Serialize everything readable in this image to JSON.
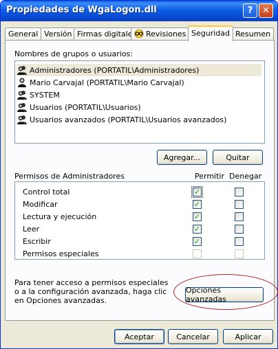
{
  "window": {
    "title": "Propiedades de WgaLogon.dll"
  },
  "titlebar_buttons": {
    "help": "?",
    "close": "✕"
  },
  "tabs": [
    {
      "label": "General"
    },
    {
      "label": "Versión"
    },
    {
      "label": "Firmas digitales"
    },
    {
      "label": "Revisiones"
    },
    {
      "label": "Seguridad"
    },
    {
      "label": "Resumen"
    }
  ],
  "groups": {
    "label": "Nombres de grupos o usuarios:",
    "items": [
      {
        "name": "Administradores (PORTATIL\\Administradores)",
        "selected": true
      },
      {
        "name": "Mario Carvajal (PORTATIL\\Mario Carvajal)",
        "selected": false
      },
      {
        "name": "SYSTEM",
        "selected": false
      },
      {
        "name": "Usuarios (PORTATIL\\Usuarios)",
        "selected": false
      },
      {
        "name": "Usuarios avanzados (PORTATIL\\Usuarios avanzados)",
        "selected": false
      }
    ],
    "add_button": "Agregar...",
    "remove_button": "Quitar"
  },
  "permissions": {
    "header": "Permisos de Administradores",
    "allow_header": "Permitir",
    "deny_header": "Denegar",
    "rows": [
      {
        "name": "Control total",
        "allow": true,
        "deny": false,
        "disabled": false
      },
      {
        "name": "Modificar",
        "allow": true,
        "deny": false,
        "disabled": false
      },
      {
        "name": "Lectura y ejecución",
        "allow": true,
        "deny": false,
        "disabled": false
      },
      {
        "name": "Leer",
        "allow": true,
        "deny": false,
        "disabled": false
      },
      {
        "name": "Escribir",
        "allow": true,
        "deny": false,
        "disabled": false
      },
      {
        "name": "Permisos especiales",
        "allow": false,
        "deny": false,
        "disabled": true
      }
    ]
  },
  "advanced": {
    "info_line1": "Para tener acceso a permisos especiales",
    "info_line2": "o a la configuración avanzada, haga clic",
    "info_line3": "en Opciones avanzadas.",
    "button": "Opciones avanzadas"
  },
  "footer": {
    "ok": "Aceptar",
    "cancel": "Cancelar",
    "apply": "Aplicar"
  },
  "colors": {
    "titlebar": "#0a5bdf",
    "tab_highlight": "#ffc83c",
    "annotation": "#b22222"
  }
}
